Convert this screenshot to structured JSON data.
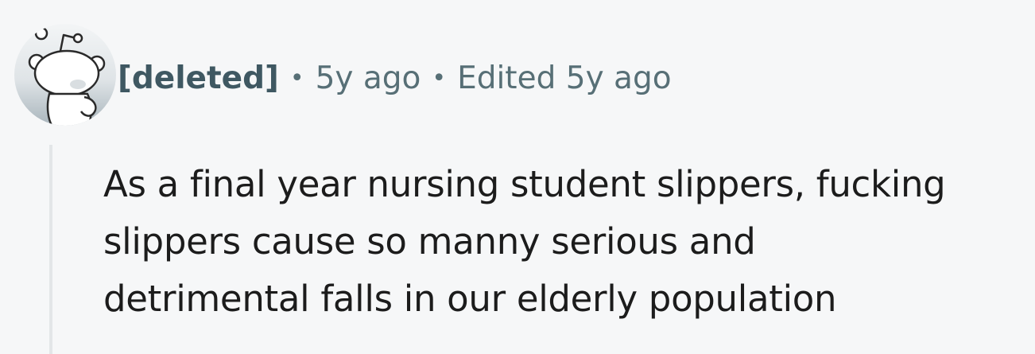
{
  "comment": {
    "author": "[deleted]",
    "separator": "•",
    "posted_time": "5y ago",
    "edited_label": "Edited 5y ago",
    "body_lines": [
      "As a final year nursing student slippers, fucking",
      "slippers cause so manny serious and",
      "detrimental falls in our elderly population"
    ],
    "avatar_icon": "snoo-avatar-icon"
  },
  "colors": {
    "background": "#f6f7f8",
    "author": "#3f5862",
    "meta": "#576f76",
    "body": "#1c1c1c",
    "thread_line": "#e3e6e8"
  }
}
